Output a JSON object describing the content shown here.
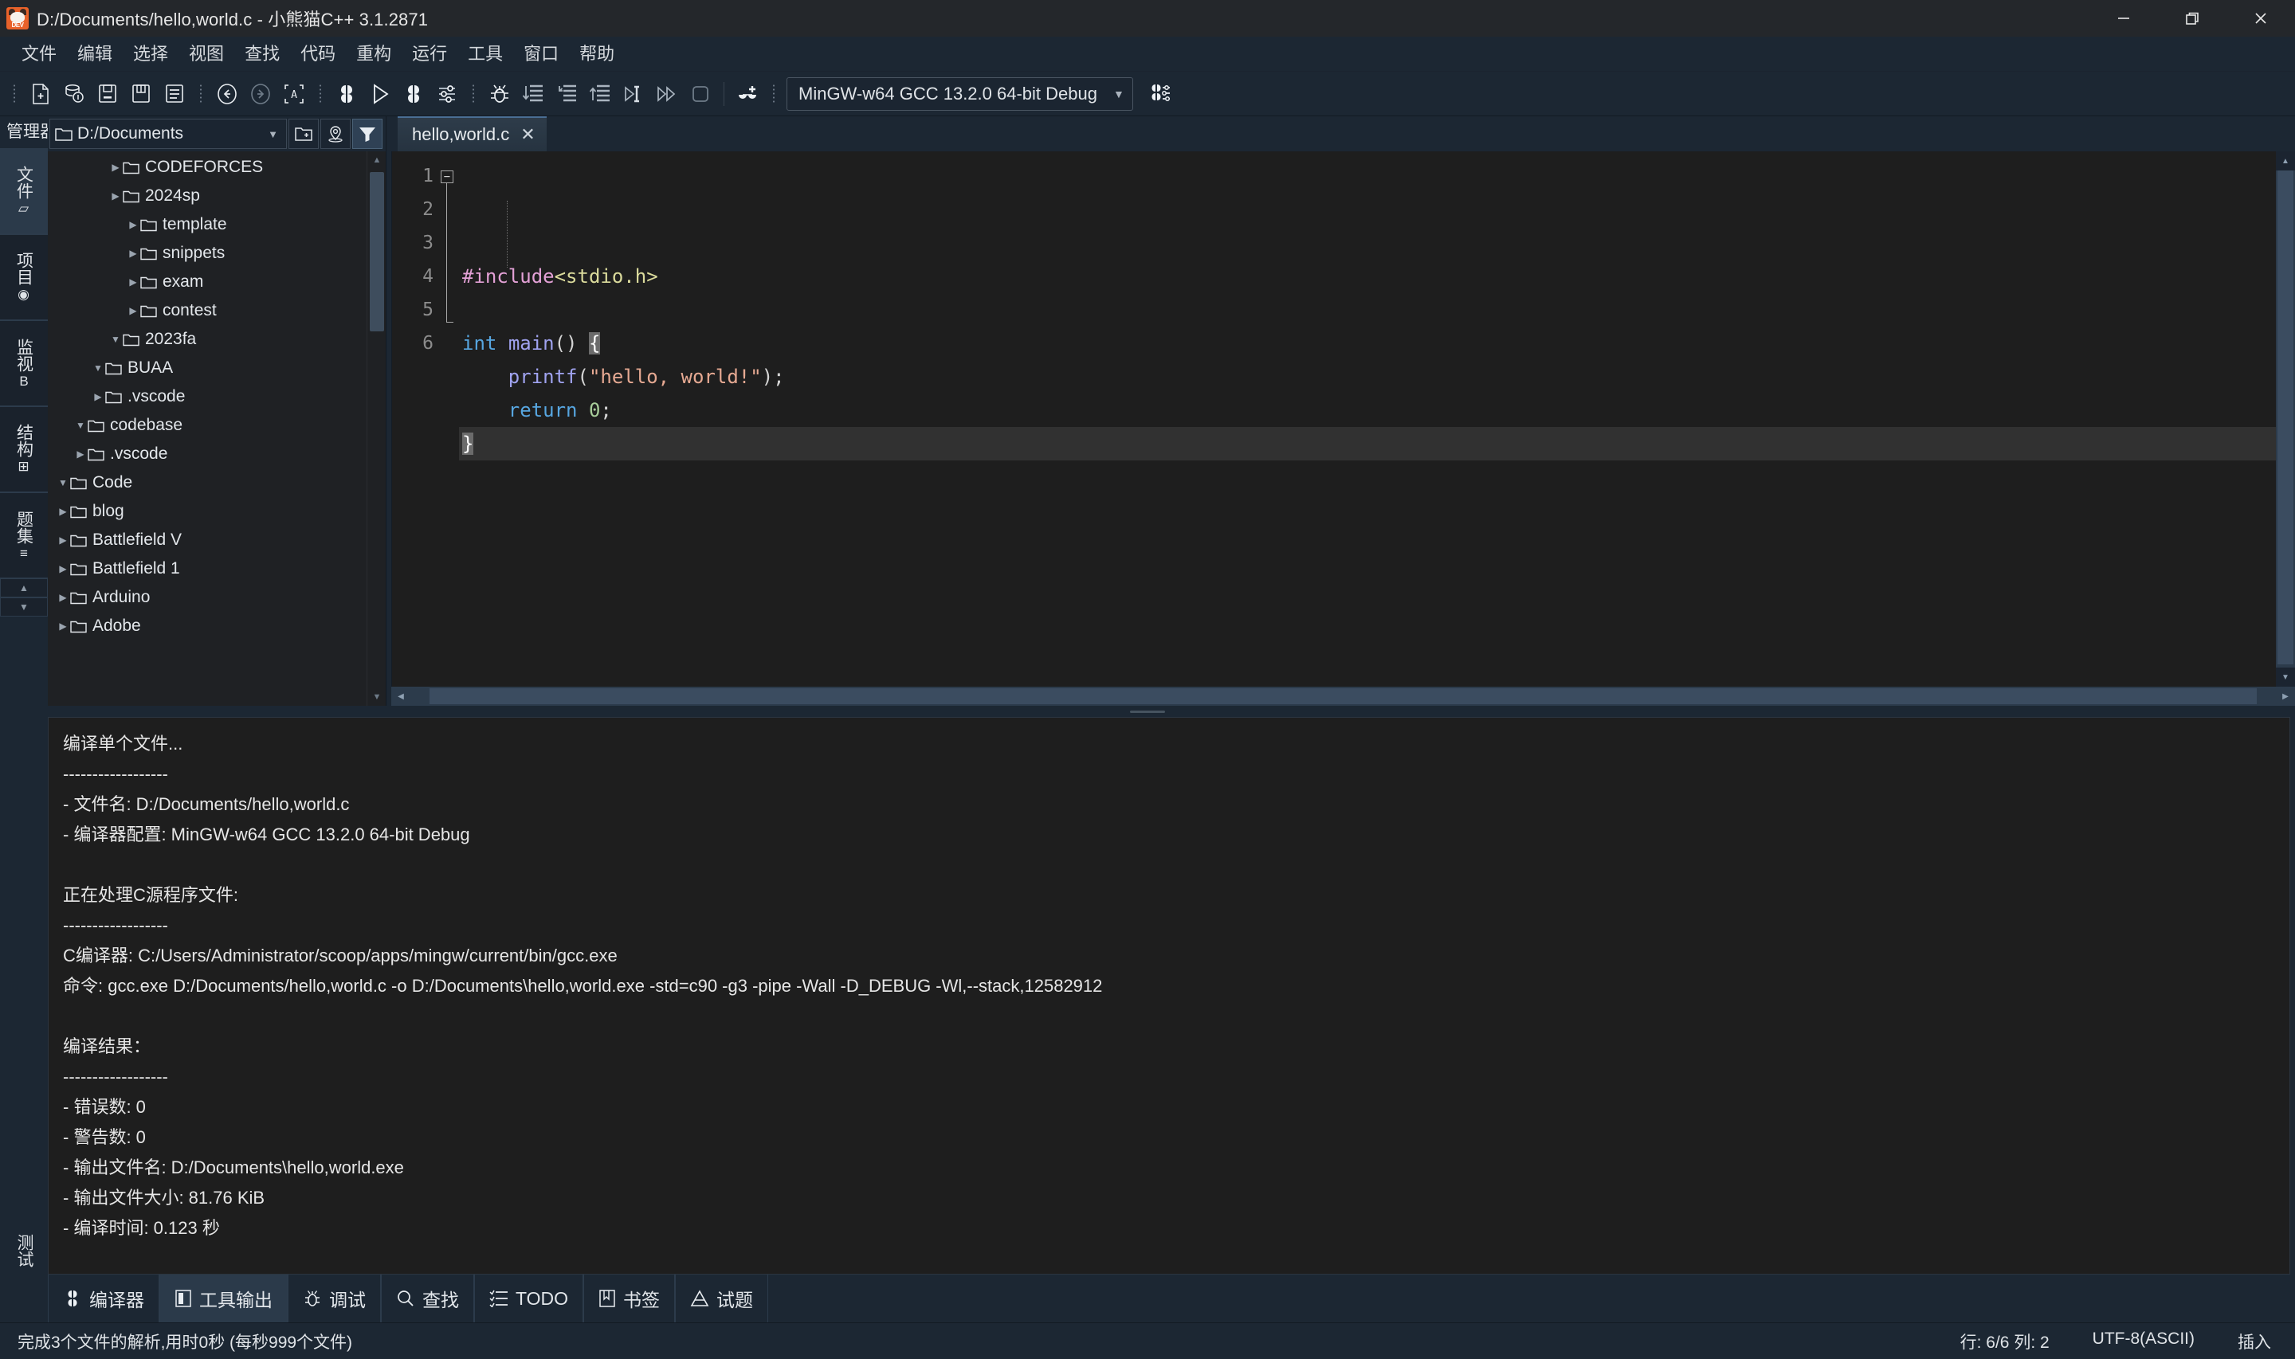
{
  "window": {
    "title": "D:/Documents/hello,world.c - 小熊猫C++ 3.1.2871",
    "app_icon_label": "DEV",
    "minimize_label": "最小化",
    "restore_label": "还原",
    "close_label": "关闭"
  },
  "menubar": {
    "items": [
      {
        "label": "文件",
        "name": "menu-file"
      },
      {
        "label": "编辑",
        "name": "menu-edit"
      },
      {
        "label": "选择",
        "name": "menu-select"
      },
      {
        "label": "视图",
        "name": "menu-view"
      },
      {
        "label": "查找",
        "name": "menu-find"
      },
      {
        "label": "代码",
        "name": "menu-code"
      },
      {
        "label": "重构",
        "name": "menu-refactor"
      },
      {
        "label": "运行",
        "name": "menu-run"
      },
      {
        "label": "工具",
        "name": "menu-tools"
      },
      {
        "label": "窗口",
        "name": "menu-window"
      },
      {
        "label": "帮助",
        "name": "menu-help"
      }
    ]
  },
  "toolbar": {
    "compiler_set": "MinGW-w64 GCC 13.2.0 64-bit Debug",
    "buttons": [
      "new-file-icon",
      "new-project-icon",
      "save-icon",
      "save-as-icon",
      "save-all-icon",
      "undo-icon",
      "redo-icon",
      "select-all-icon",
      "compile-icon",
      "run-icon",
      "compile-run-icon",
      "options-icon",
      "debug-icon",
      "step-over-icon",
      "step-into-icon",
      "step-out-icon",
      "run-to-cursor-icon",
      "continue-icon",
      "stop-icon",
      "add-watch-icon",
      "compiler-options-icon"
    ]
  },
  "left_panel": {
    "header": "管理器",
    "vertical_tabs": [
      {
        "label": "文件",
        "glyph": "▱",
        "active": true,
        "name": "vtab-files"
      },
      {
        "label": "项目",
        "glyph": "◉",
        "active": false,
        "name": "vtab-project"
      },
      {
        "label": "监视",
        "glyph": "B",
        "active": false,
        "name": "vtab-watch"
      },
      {
        "label": "结构",
        "glyph": "⊞",
        "active": false,
        "name": "vtab-structure"
      },
      {
        "label": "题集",
        "glyph": "≡",
        "active": false,
        "name": "vtab-problemset"
      }
    ],
    "path": "D:/Documents",
    "toolbuttons": [
      "new-folder-icon",
      "locate-icon",
      "filter-icon"
    ],
    "tree": [
      {
        "label": "Adobe",
        "depth": 0,
        "state": "collapsed"
      },
      {
        "label": "Arduino",
        "depth": 0,
        "state": "collapsed"
      },
      {
        "label": "Battlefield 1",
        "depth": 0,
        "state": "collapsed"
      },
      {
        "label": "Battlefield V",
        "depth": 0,
        "state": "collapsed"
      },
      {
        "label": "blog",
        "depth": 0,
        "state": "collapsed"
      },
      {
        "label": "Code",
        "depth": 0,
        "state": "expanded"
      },
      {
        "label": ".vscode",
        "depth": 1,
        "state": "collapsed"
      },
      {
        "label": "codebase",
        "depth": 1,
        "state": "expanded"
      },
      {
        "label": ".vscode",
        "depth": 2,
        "state": "collapsed"
      },
      {
        "label": "BUAA",
        "depth": 2,
        "state": "expanded"
      },
      {
        "label": "2023fa",
        "depth": 3,
        "state": "expanded"
      },
      {
        "label": "contest",
        "depth": 4,
        "state": "collapsed"
      },
      {
        "label": "exam",
        "depth": 4,
        "state": "collapsed"
      },
      {
        "label": "snippets",
        "depth": 4,
        "state": "collapsed"
      },
      {
        "label": "template",
        "depth": 4,
        "state": "collapsed"
      },
      {
        "label": "2024sp",
        "depth": 3,
        "state": "collapsed"
      },
      {
        "label": "CODEFORCES",
        "depth": 3,
        "state": "collapsed"
      }
    ]
  },
  "editor": {
    "tab_label": "hello,world.c",
    "tab_close": "✕",
    "lines": [
      {
        "no": "1",
        "tokens": [
          {
            "t": "#include",
            "c": "k-pp"
          },
          {
            "t": "<stdio.h>",
            "c": "k-hdr"
          }
        ]
      },
      {
        "no": "2",
        "tokens": []
      },
      {
        "no": "3",
        "tokens": [
          {
            "t": "int",
            "c": "k-type"
          },
          {
            "t": " ",
            "c": "k-plain"
          },
          {
            "t": "main",
            "c": "k-fn"
          },
          {
            "t": "() ",
            "c": "k-plain"
          },
          {
            "t": "{",
            "c": "brace-hl"
          }
        ]
      },
      {
        "no": "4",
        "tokens": [
          {
            "t": "    ",
            "c": "k-plain"
          },
          {
            "t": "printf",
            "c": "k-fn"
          },
          {
            "t": "(",
            "c": "k-plain"
          },
          {
            "t": "\"hello, world!\"",
            "c": "k-str"
          },
          {
            "t": ");",
            "c": "k-plain"
          }
        ]
      },
      {
        "no": "5",
        "tokens": [
          {
            "t": "    ",
            "c": "k-plain"
          },
          {
            "t": "return",
            "c": "k-type"
          },
          {
            "t": " ",
            "c": "k-plain"
          },
          {
            "t": "0",
            "c": "k-num"
          },
          {
            "t": ";",
            "c": "k-plain"
          }
        ]
      },
      {
        "no": "6",
        "tokens": [
          {
            "t": "}",
            "c": "brace-hl"
          }
        ],
        "current": true
      }
    ]
  },
  "console": {
    "text": "编译单个文件...\n------------------\n- 文件名: D:/Documents/hello,world.c\n- 编译器配置: MinGW-w64 GCC 13.2.0 64-bit Debug\n\n正在处理C源程序文件:\n------------------\nC编译器: C:/Users/Administrator/scoop/apps/mingw/current/bin/gcc.exe\n命令: gcc.exe D:/Documents/hello,world.c -o D:/Documents\\hello,world.exe -std=c90 -g3 -pipe -Wall -D_DEBUG -Wl,--stack,12582912\n\n编译结果：\n------------------\n- 错误数: 0\n- 警告数: 0\n- 输出文件名: D:/Documents\\hello,world.exe\n- 输出文件大小: 81.76 KiB\n- 编译时间: 0.123 秒",
    "side_tab": "测试"
  },
  "bottom_tabs": [
    {
      "label": "编译器",
      "icon": "compiler-icon",
      "active": false,
      "name": "btab-compiler"
    },
    {
      "label": "工具输出",
      "icon": "tool-output-icon",
      "active": true,
      "name": "btab-tool-output"
    },
    {
      "label": "调试",
      "icon": "debug-bug-icon",
      "active": false,
      "name": "btab-debug"
    },
    {
      "label": "查找",
      "icon": "search-icon",
      "active": false,
      "name": "btab-find"
    },
    {
      "label": "TODO",
      "icon": "todo-list-icon",
      "active": false,
      "name": "btab-todo"
    },
    {
      "label": "书签",
      "icon": "bookmark-icon",
      "active": false,
      "name": "btab-bookmark"
    },
    {
      "label": "试题",
      "icon": "problem-icon",
      "active": false,
      "name": "btab-problem"
    }
  ],
  "statusbar": {
    "message": "完成3个文件的解析,用时0秒 (每秒999个文件)",
    "cursor": "行: 6/6 列: 2",
    "encoding": "UTF-8(ASCII)",
    "insert_mode": "插入"
  }
}
